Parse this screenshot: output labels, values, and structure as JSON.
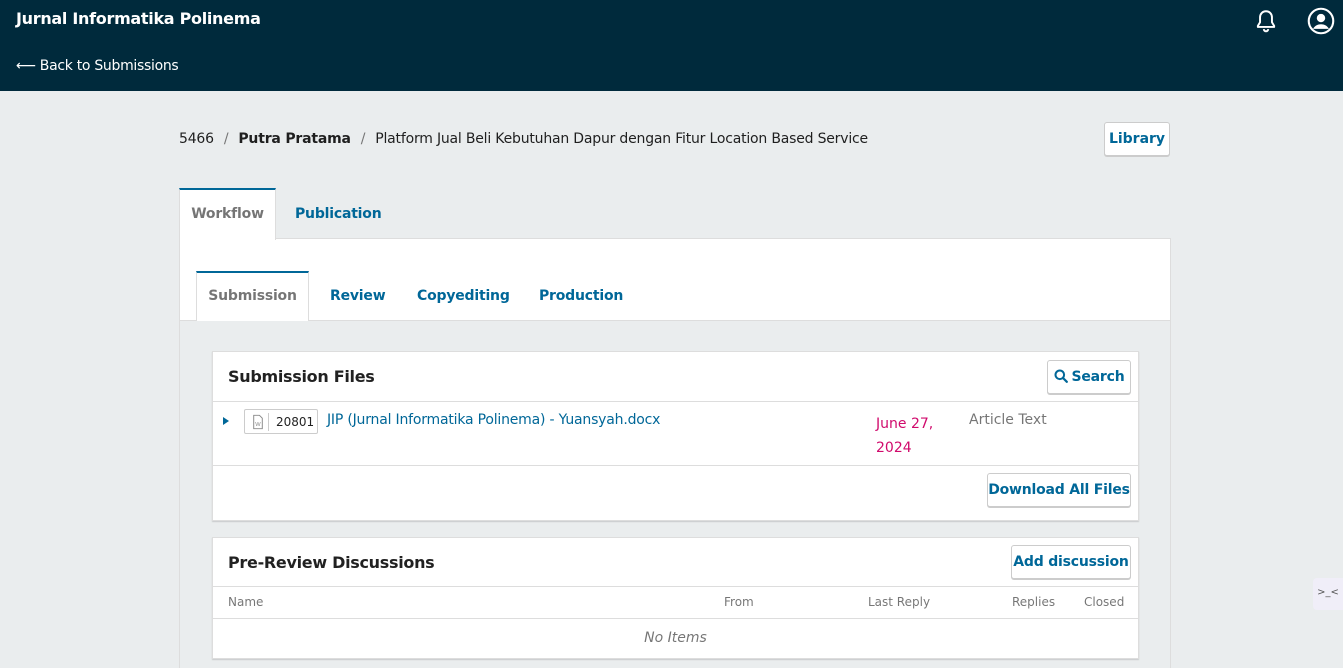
{
  "header": {
    "site_title": "Jurnal Informatika Polinema",
    "back_link": "Back to Submissions",
    "back_arrow": "⟵"
  },
  "breadcrumb": {
    "id": "5466",
    "author": "Putra Pratama",
    "title": "Platform Jual Beli Kebutuhan Dapur dengan Fitur Location Based Service",
    "separator": "/"
  },
  "library_label": "Library",
  "main_tabs": [
    {
      "label": "Workflow",
      "active": true
    },
    {
      "label": "Publication",
      "active": false
    }
  ],
  "stage_tabs": [
    {
      "label": "Submission",
      "active": true
    },
    {
      "label": "Review",
      "active": false
    },
    {
      "label": "Copyediting",
      "active": false
    },
    {
      "label": "Production",
      "active": false
    }
  ],
  "submission_files": {
    "title": "Submission Files",
    "search_label": "Search",
    "files": [
      {
        "id": "20801",
        "name": "JIP (Jurnal Informatika Polinema) - Yuansyah.docx",
        "date_line1": "June 27,",
        "date_line2": "2024",
        "type": "Article Text"
      }
    ],
    "download_all_label": "Download All Files"
  },
  "discussions": {
    "title": "Pre-Review Discussions",
    "add_label": "Add discussion",
    "columns": [
      "Name",
      "From",
      "Last Reply",
      "Replies",
      "Closed"
    ],
    "empty_text": "No Items"
  },
  "help_tab_label": ">_<",
  "colors": {
    "header_bg": "#002a3c",
    "accent": "#006798",
    "date": "#d00a6c",
    "page_bg": "#eaedee"
  }
}
